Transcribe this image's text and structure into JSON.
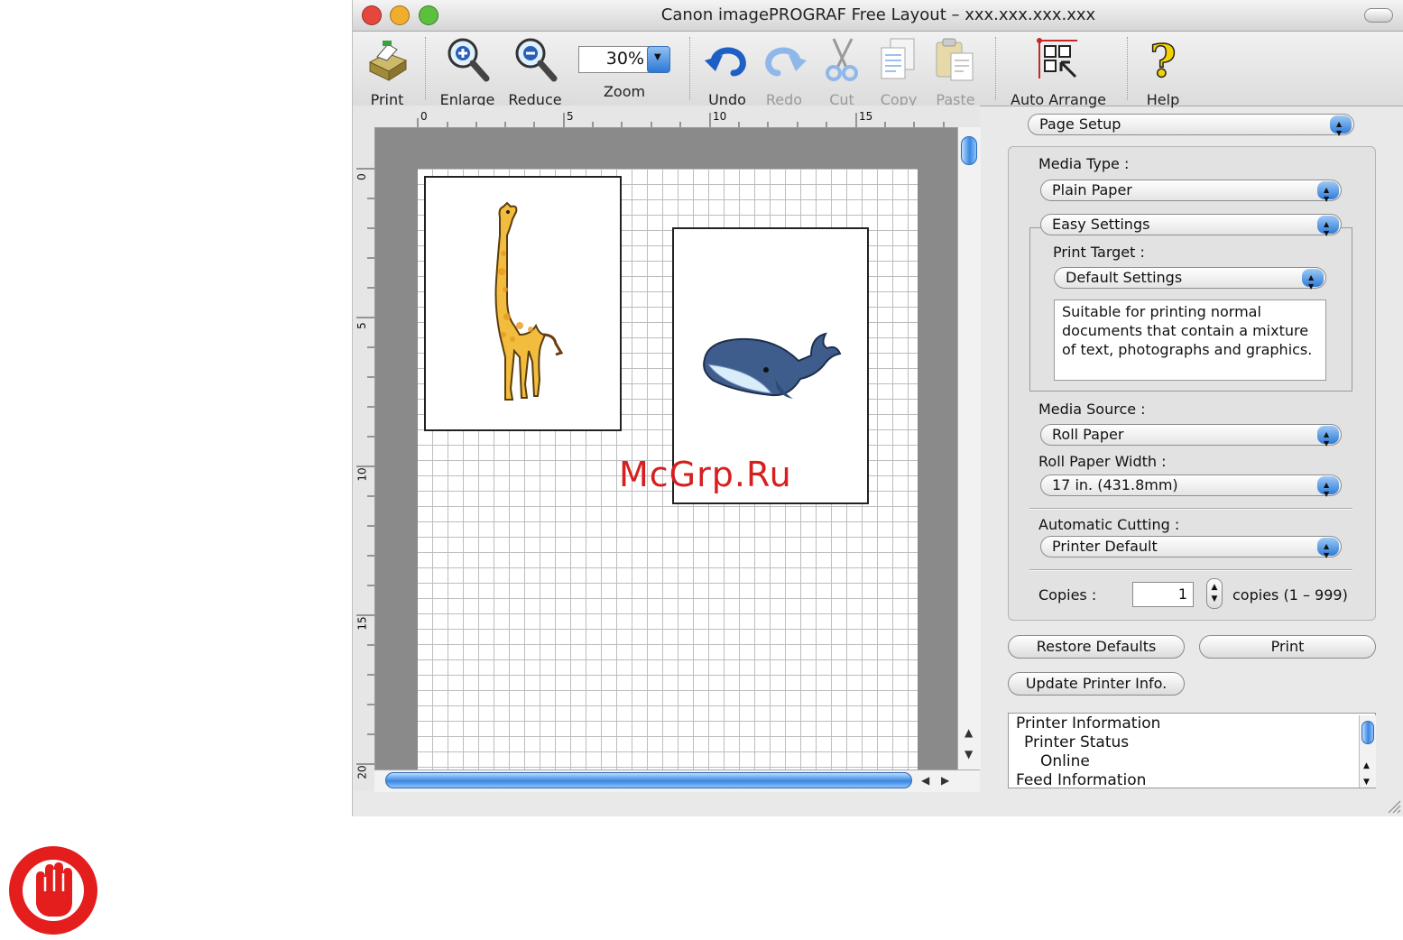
{
  "window": {
    "title": "Canon imagePROGRAF Free Layout – xxx.xxx.xxx.xxx",
    "traffic_colors": [
      "#e5473f",
      "#f1ae2e",
      "#5cc03f"
    ]
  },
  "toolbar": {
    "print": "Print",
    "enlarge": "Enlarge",
    "reduce": "Reduce",
    "zoom_label": "Zoom",
    "zoom_value": "30%",
    "undo": "Undo",
    "redo": "Redo",
    "cut": "Cut",
    "copy": "Copy",
    "paste": "Paste",
    "auto_arrange": "Auto Arrange",
    "help": "Help"
  },
  "rulers": {
    "horizontal": [
      "0",
      "5",
      "10",
      "15"
    ],
    "vertical": [
      "0",
      "5",
      "10",
      "15",
      "20"
    ]
  },
  "watermark": "McGrp.Ru",
  "panel": {
    "section": "Page Setup",
    "media_type_label": "Media Type :",
    "media_type": "Plain Paper",
    "settings_mode": "Easy Settings",
    "print_target_label": "Print Target :",
    "print_target": "Default Settings",
    "description": "Suitable for printing normal documents that contain a mixture of text, photographs and graphics.",
    "media_source_label": "Media Source :",
    "media_source": "Roll Paper",
    "roll_width_label": "Roll Paper Width :",
    "roll_width": "17 in. (431.8mm)",
    "auto_cut_label": "Automatic Cutting :",
    "auto_cut": "Printer Default",
    "copies_label": "Copies :",
    "copies_value": "1",
    "copies_range": "copies (1 – 999)",
    "restore_defaults": "Restore Defaults",
    "print_button": "Print",
    "update_info": "Update Printer Info."
  },
  "printer_info": {
    "lines": [
      "Printer Information",
      "Printer Status",
      "Online",
      "Feed Information"
    ]
  }
}
